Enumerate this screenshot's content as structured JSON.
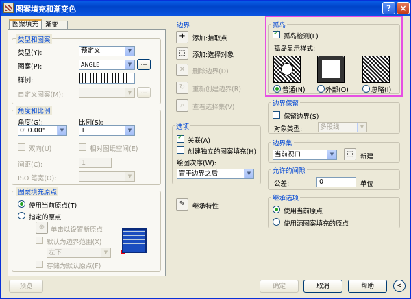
{
  "window": {
    "title": "图案填充和渐变色",
    "help": "?",
    "close": "×"
  },
  "tabs": [
    "图案填充",
    "渐变色"
  ],
  "type_group": {
    "title": "类型和图案",
    "type_label": "类型(Y):",
    "type_value": "预定义",
    "pattern_label": "图案(P):",
    "pattern_value": "ANGLE",
    "pattern_btn": "...",
    "swatch_label": "样例:",
    "custom_label": "自定义图案(M):",
    "custom_btn": "..."
  },
  "angle_group": {
    "title": "角度和比例",
    "angle_label": "角度(G):",
    "angle_value": "0' 0.00\"",
    "scale_label": "比例(S):",
    "scale_value": "1",
    "double_label": "双向(U)",
    "relative_label": "相对图纸空间(E)",
    "spacing_label": "间距(C):",
    "spacing_value": "1",
    "iso_label": "ISO 笔宽(O):"
  },
  "origin_group": {
    "title": "图案填充原点",
    "use_current": "使用当前原点(T)",
    "specified": "指定的原点",
    "click_set": "单击以设置新原点",
    "default_extent": "默认为边界范围(X)",
    "position_value": "左下",
    "store_default": "存储为默认原点(F)"
  },
  "border_group": {
    "title": "边界",
    "add_pick": "添加:拾取点",
    "add_select": "添加:选择对象",
    "remove": "删除边界(D)",
    "recreate": "重新创建边界(R)",
    "view_sel": "查看选择集(V)"
  },
  "options_group": {
    "title": "选项",
    "assoc": "关联(A)",
    "independent": "创建独立的图案填充(H)",
    "order_label": "绘图次序(W):",
    "order_value": "置于边界之后"
  },
  "inherit": "继承特性",
  "island_group": {
    "title": "孤岛",
    "detect": "孤岛检测(L)",
    "style_label": "孤岛显示样式:",
    "normal": "普通(N)",
    "outer": "外部(O)",
    "ignore": "忽略(I)"
  },
  "boundary_keep": {
    "title": "边界保留",
    "keep": "保留边界(S)",
    "obj_type_label": "对象类型:",
    "obj_type_value": "多段线"
  },
  "boundary_set": {
    "title": "边界集",
    "value": "当前视口",
    "new": "新建"
  },
  "gap": {
    "title": "允许的间隙",
    "tol_label": "公差:",
    "tol_value": "0",
    "unit": "单位"
  },
  "inherit_opts": {
    "title": "继承选项",
    "use_current": "使用当前原点",
    "use_source": "使用源图案填充的原点"
  },
  "footer": {
    "preview": "预览",
    "ok": "确定",
    "cancel": "取消",
    "help": "帮助",
    "collapse": "<"
  }
}
